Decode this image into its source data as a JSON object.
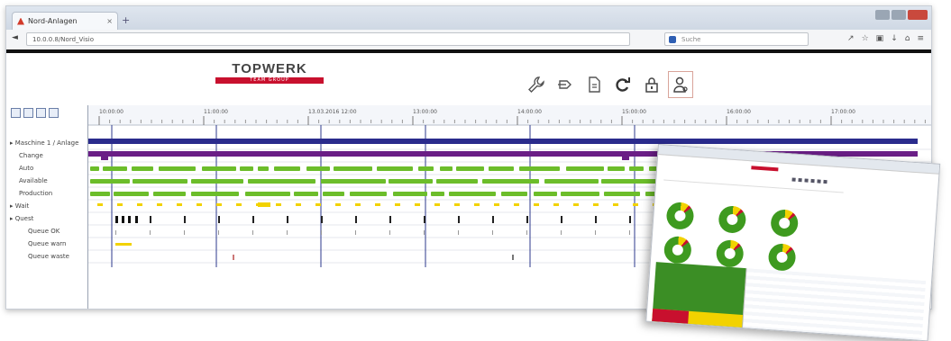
{
  "browser": {
    "tab_title": "Nord-Anlagen",
    "url": "10.0.0.8/Nord_Visio",
    "search_placeholder": "Suche"
  },
  "brand": {
    "name": "TOPWERK",
    "subtitle": "TEAM GROUP",
    "color": "#c8102e"
  },
  "toolbar": {
    "icons": [
      "wrench-icon",
      "export-icon",
      "document-icon",
      "refresh-icon",
      "lock-icon",
      "users-icon"
    ],
    "active_index": 5
  },
  "timeline": {
    "ticks": [
      "10:00:00",
      "11:00:00",
      "13.03.2016 12:00",
      "13:00:00",
      "14:00:00",
      "15:00:00",
      "16:00:00",
      "17:00:00"
    ],
    "rows": [
      {
        "label": "Maschine 1 / Anlage",
        "indent": 0
      },
      {
        "label": "Change",
        "indent": 1
      },
      {
        "label": "Auto",
        "indent": 1
      },
      {
        "label": "Available",
        "indent": 1
      },
      {
        "label": "Production",
        "indent": 1
      },
      {
        "label": "Wait",
        "indent": 0
      },
      {
        "label": "Quest",
        "indent": 0
      },
      {
        "label": "Queue OK",
        "indent": 2
      },
      {
        "label": "Queue warn",
        "indent": 2
      },
      {
        "label": "Queue waste",
        "indent": 2
      }
    ],
    "colors": {
      "navy": "#2a2b8c",
      "purple": "#6a1e86",
      "green": "#6cbd2a",
      "yellow": "#f2d200",
      "marker": "#2c3a8c"
    }
  }
}
